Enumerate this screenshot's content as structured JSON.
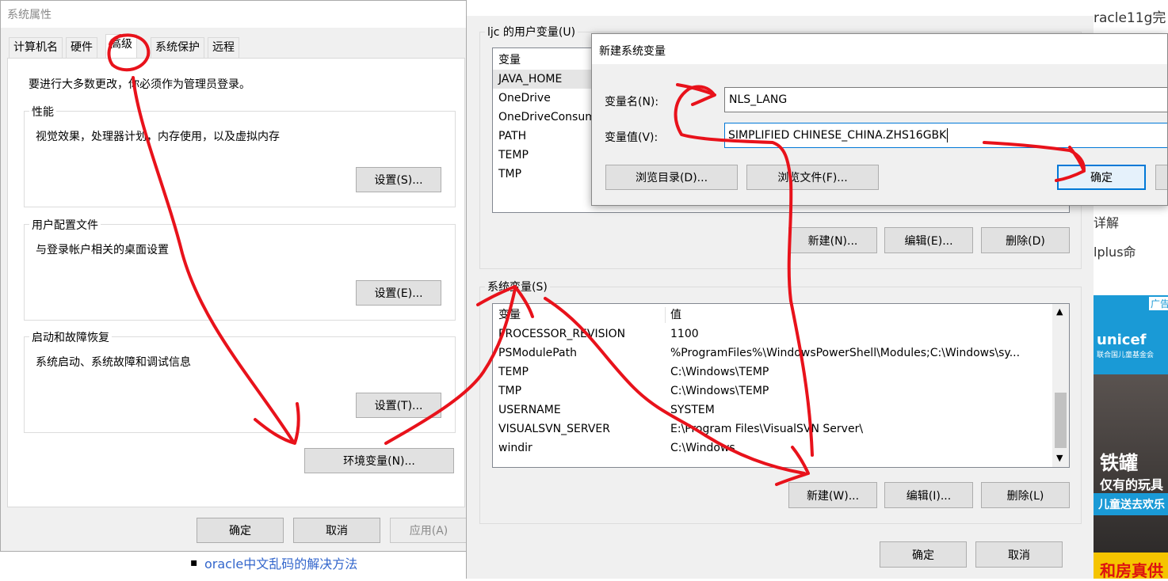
{
  "background_page": {
    "title_fragment": "racle11g完",
    "text_fragment_1": "详解",
    "text_fragment_2": "lplus命",
    "ad_label": "广告",
    "ad_unicef": "unicef",
    "ad_unicef_cn": "联合国儿童基金会",
    "ad_text_1": "铁罐",
    "ad_text_2": "仅有的玩具",
    "ad_text_3": "儿童送去欢乐",
    "ad_text_4": "和房真供",
    "bullet_link": "oracle中文乱码的解决方法"
  },
  "system_properties": {
    "title": "系统属性",
    "tabs": [
      {
        "label": "计算机名"
      },
      {
        "label": "硬件"
      },
      {
        "label": "高级"
      },
      {
        "label": "系统保护"
      },
      {
        "label": "远程"
      }
    ],
    "admin_note": "要进行大多数更改，你必须作为管理员登录。",
    "performance": {
      "title": "性能",
      "desc": "视觉效果，处理器计划，内存使用，以及虚拟内存",
      "button": "设置(S)..."
    },
    "user_profile": {
      "title": "用户配置文件",
      "desc": "与登录帐户相关的桌面设置",
      "button": "设置(E)..."
    },
    "startup": {
      "title": "启动和故障恢复",
      "desc": "系统启动、系统故障和调试信息",
      "button": "设置(T)..."
    },
    "env_button": "环境变量(N)...",
    "ok": "确定",
    "cancel": "取消",
    "apply": "应用(A)"
  },
  "env_vars": {
    "user_section_title": "ljc 的用户变量(U)",
    "user_header_var": "变量",
    "user_rows": [
      "JAVA_HOME",
      "OneDrive",
      "OneDriveConsum",
      "PATH",
      "TEMP",
      "TMP"
    ],
    "user_new": "新建(N)...",
    "user_edit": "编辑(E)...",
    "user_delete": "删除(D)",
    "system_section_title": "系统变量(S)",
    "system_header_var": "变量",
    "system_header_val": "值",
    "system_rows": [
      {
        "name": "PROCESSOR_REVISION",
        "value": "1100"
      },
      {
        "name": "PSModulePath",
        "value": "%ProgramFiles%\\WindowsPowerShell\\Modules;C:\\Windows\\sy..."
      },
      {
        "name": "TEMP",
        "value": "C:\\Windows\\TEMP"
      },
      {
        "name": "TMP",
        "value": "C:\\Windows\\TEMP"
      },
      {
        "name": "USERNAME",
        "value": "SYSTEM"
      },
      {
        "name": "VISUALSVN_SERVER",
        "value": "E:\\Program Files\\VisualSVN Server\\"
      },
      {
        "name": "windir",
        "value": "C:\\Windows"
      }
    ],
    "system_new": "新建(W)...",
    "system_edit": "编辑(I)...",
    "system_delete": "删除(L)",
    "ok": "确定",
    "cancel": "取消"
  },
  "new_var_dialog": {
    "title": "新建系统变量",
    "name_label": "变量名(N):",
    "name_value": "NLS_LANG",
    "value_label": "变量值(V):",
    "value_value": "SIMPLIFIED CHINESE_CHINA.ZHS16GBK",
    "browse_dir": "浏览目录(D)...",
    "browse_file": "浏览文件(F)...",
    "ok": "确定"
  },
  "colors": {
    "annotation": "#e8121b",
    "focus": "#0078d7",
    "dialog_bg": "#f0f0f0"
  }
}
